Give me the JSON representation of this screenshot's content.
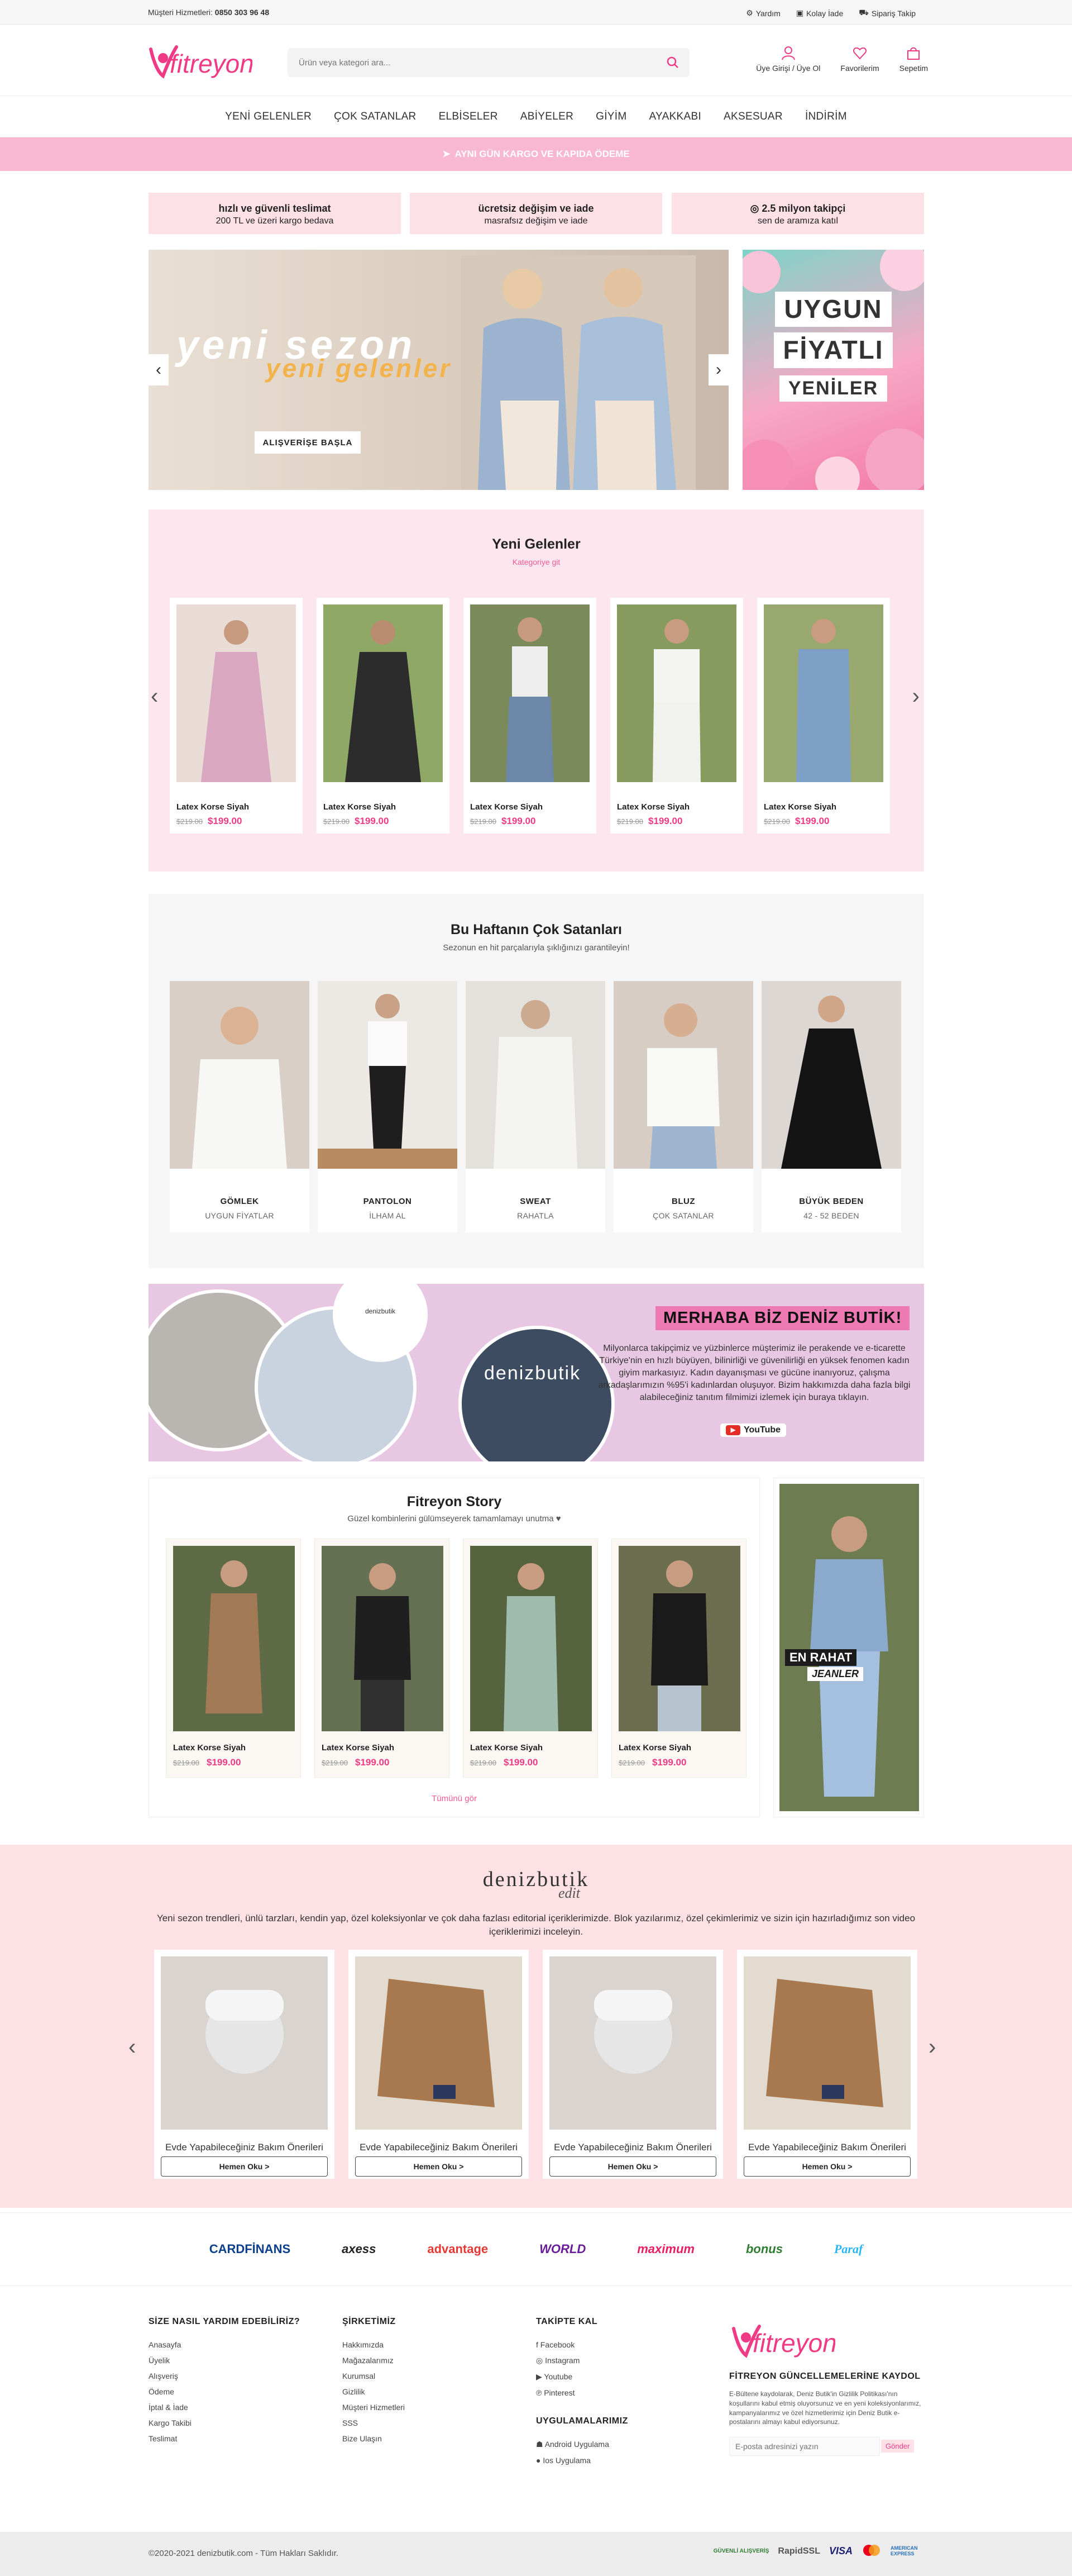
{
  "topbar": {
    "phone_label": "Müşteri Hizmetleri:",
    "phone": "0850 303 96 48",
    "links": [
      "Yardım",
      "Kolay İade",
      "Sipariş Takip"
    ]
  },
  "header": {
    "logo": "fitreyon",
    "search_placeholder": "Ürün veya kategori ara...",
    "actions": [
      "Üye Girişi / Üye Ol",
      "Favorilerim",
      "Sepetim"
    ]
  },
  "nav": [
    "YENİ GELENLER",
    "ÇOK SATANLAR",
    "ELBİSELER",
    "ABİYELER",
    "GİYİM",
    "AYAKKABI",
    "AKSESUAR",
    "İNDİRİM"
  ],
  "promo": "AYNI GÜN KARGO VE KAPIDA ÖDEME",
  "features": [
    {
      "title": "hızlı ve güvenli teslimat",
      "sub": "200 TL ve üzeri kargo bedava"
    },
    {
      "title": "ücretsiz değişim ve iade",
      "sub": "masrafsız değişim ve iade"
    },
    {
      "title": "2.5 milyon takipçi",
      "sub": "sen de aramıza katıl"
    }
  ],
  "hero": {
    "title1": "yeni sezon",
    "title2": "yeni gelenler",
    "cta": "ALIŞVERİŞE BAŞLA",
    "side_lines": [
      "UYGUN",
      "FİYATLI",
      "YENİLER"
    ]
  },
  "new_arrivals": {
    "title": "Yeni Gelenler",
    "link": "Kategoriye git",
    "products": [
      {
        "name": "Latex Korse Siyah",
        "old": "$219.00",
        "price": "$199.00"
      },
      {
        "name": "Latex Korse Siyah",
        "old": "$219.00",
        "price": "$199.00"
      },
      {
        "name": "Latex Korse Siyah",
        "old": "$219.00",
        "price": "$199.00"
      },
      {
        "name": "Latex Korse Siyah",
        "old": "$219.00",
        "price": "$199.00"
      },
      {
        "name": "Latex Korse Siyah",
        "old": "$219.00",
        "price": "$199.00"
      }
    ]
  },
  "bestsellers": {
    "title": "Bu Haftanın Çok Satanları",
    "sub": "Sezonun en hit parçalarıyla şıklığınızı garantileyin!",
    "items": [
      {
        "title": "GÖMLEK",
        "sub": "UYGUN FİYATLAR"
      },
      {
        "title": "PANTOLON",
        "sub": "İLHAM AL"
      },
      {
        "title": "SWEAT",
        "sub": "RAHATLA"
      },
      {
        "title": "BLUZ",
        "sub": "ÇOK SATANLAR"
      },
      {
        "title": "BÜYÜK BEDEN",
        "sub": "42 - 52 BEDEN"
      }
    ]
  },
  "about": {
    "title": "MERHABA BİZ DENİZ BUTİK!",
    "text": "Milyonlarca takipçimiz ve yüzbinlerce müşterimiz ile perakende ve e-ticarette Türkiye'nin en hızlı büyüyen, bilinirliği ve güvenilirliği en yüksek fenomen kadın giyim markasıyız. Kadın dayanışması ve gücüne inanıyoruz, çalışma arkadaşlarımızın %95'i kadınlardan oluşuyor. Bizim hakkımızda daha fazla bilgi alabileceğiniz tanıtım filmimizi izlemek için buraya tıklayın.",
    "youtube": "YouTube",
    "store_sign": "denizbutik"
  },
  "story": {
    "title": "Fitreyon Story",
    "sub": "Güzel kombinlerini gülümseyerek tamamlamayı unutma ♥",
    "link": "Tümünü gör",
    "products": [
      {
        "name": "Latex Korse Siyah",
        "old": "$219.00",
        "price": "$199.00"
      },
      {
        "name": "Latex Korse Siyah",
        "old": "$219.00",
        "price": "$199.00"
      },
      {
        "name": "Latex Korse Siyah",
        "old": "$219.00",
        "price": "$199.00"
      },
      {
        "name": "Latex Korse Siyah",
        "old": "$219.00",
        "price": "$199.00"
      }
    ],
    "side_line1": "EN RAHAT",
    "side_line2": "JEANLER"
  },
  "edit": {
    "brand": "denizbutik",
    "brand2": "edit",
    "text": "Yeni sezon trendleri, ünlü tarzları, kendin yap, özel koleksiyonlar ve çok daha fazlası editorial içeriklerimizde. Blok yazılarımız, özel çekimlerimiz ve sizin için hazırladığımız son video içeriklerimizi inceleyin.",
    "posts": [
      {
        "title": "Evde Yapabileceğiniz Bakım Önerileri",
        "button": "Hemen Oku >"
      },
      {
        "title": "Evde Yapabileceğiniz Bakım Önerileri",
        "button": "Hemen Oku >"
      },
      {
        "title": "Evde Yapabileceğiniz Bakım Önerileri",
        "button": "Hemen Oku >"
      },
      {
        "title": "Evde Yapabileceğiniz Bakım Önerileri",
        "button": "Hemen Oku >"
      }
    ]
  },
  "card_logos": [
    "CARDFİNANS",
    "axess",
    "advantage",
    "WORLD",
    "maximum",
    "bonus",
    "Paraf"
  ],
  "footer": {
    "col1": {
      "title": "SİZE NASIL YARDIM EDEBİLİRİZ?",
      "links": [
        "Anasayfa",
        "Üyelik",
        "Alışveriş",
        "Ödeme",
        "İptal & İade",
        "Kargo Takibi",
        "Teslimat"
      ]
    },
    "col2": {
      "title": "ŞİRKETİMİZ",
      "links": [
        "Hakkımızda",
        "Mağazalarımız",
        "Kurumsal",
        "Gizlilik",
        "Müşteri Hizmetleri",
        "SSS",
        "Bize Ulaşın"
      ]
    },
    "col3": {
      "title": "TAKİPTE KAL",
      "links": [
        "Facebook",
        "Instagram",
        "Youtube",
        "Pinterest"
      ]
    },
    "col3b": {
      "title": "UYGULAMALARIMIZ",
      "links": [
        "Android Uygulama",
        "Ios Uygulama"
      ]
    },
    "newsletter": {
      "title": "FİTREYON GÜNCELLEMELERİNE KAYDOL",
      "text": "E-Bültene kaydolarak, Deniz Butik'in Gizlilik Politikası'nın koşullarını kabul etmiş oluyorsunuz ve en yeni koleksiyonlarımız, kampanyalarımız ve özel hizmetlerimiz için Deniz Butik e-postalarını almayı kabul ediyorsunuz.",
      "placeholder": "E-posta adresinizi yazın",
      "button": "Gönder"
    }
  },
  "bottom": {
    "copyright": "©2020-2021 denizbutik.com - Tüm Hakları Saklıdır.",
    "badges": [
      "GÜVENLİ ALIŞVERİŞ",
      "RapidSSL",
      "VISA",
      "MASTERCARD",
      "AMERICAN EXPRESS"
    ]
  },
  "colors": {
    "accent": "#ef3b85",
    "promo": "#f7b8d0",
    "pink_bg": "#fde6ed",
    "feature_bg": "#fde1e7"
  }
}
